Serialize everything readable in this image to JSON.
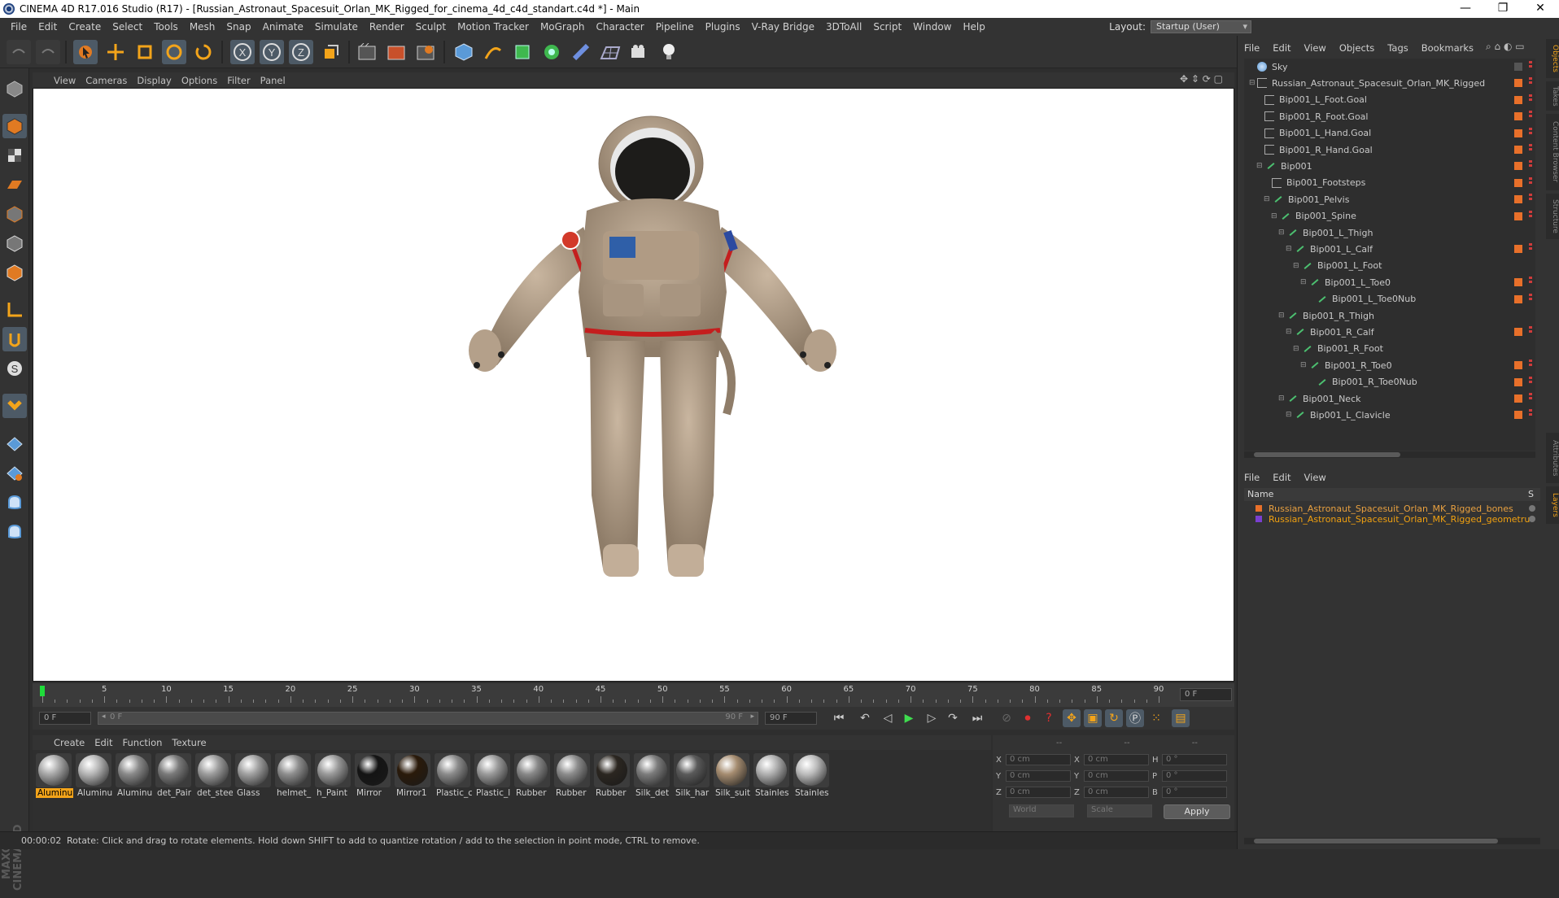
{
  "window": {
    "title": "CINEMA 4D R17.016 Studio (R17) - [Russian_Astronaut_Spacesuit_Orlan_MK_Rigged_for_cinema_4d_c4d_standart.c4d *] - Main",
    "minimize": "—",
    "restore": "❐",
    "close": "✕"
  },
  "menu": [
    "File",
    "Edit",
    "Create",
    "Select",
    "Tools",
    "Mesh",
    "Snap",
    "Animate",
    "Simulate",
    "Render",
    "Sculpt",
    "Motion Tracker",
    "MoGraph",
    "Character",
    "Pipeline",
    "Plugins",
    "V-Ray Bridge",
    "3DToAll",
    "Script",
    "Window",
    "Help"
  ],
  "layout": {
    "label": "Layout:",
    "value": "Startup (User)"
  },
  "toolbar": {
    "undo": "undo-icon",
    "redo": "redo-icon",
    "select": "select-icon",
    "move": "move-icon",
    "scale": "scale-icon",
    "rotate": "rotate-icon",
    "x_axis": "X",
    "y_axis": "Y",
    "z_axis": "Z"
  },
  "viewport_menu": [
    "View",
    "Cameras",
    "Display",
    "Options",
    "Filter",
    "Panel"
  ],
  "timeline": {
    "ticks": [
      "0",
      "5",
      "10",
      "15",
      "20",
      "25",
      "30",
      "35",
      "40",
      "45",
      "50",
      "55",
      "60",
      "65",
      "70",
      "75",
      "80",
      "85",
      "90"
    ],
    "current_frame": "0 F",
    "start_frame": "0 F",
    "range_start": "0 F",
    "range_end": "90 F",
    "end_frame": "90 F"
  },
  "material_menu": [
    "Create",
    "Edit",
    "Function",
    "Texture"
  ],
  "materials": [
    {
      "label": "Aluminu",
      "color": "#a8a8a8",
      "active": true
    },
    {
      "label": "Aluminu",
      "color": "#b5b5b5"
    },
    {
      "label": "Aluminu",
      "color": "#8a8a8a"
    },
    {
      "label": "det_Pair",
      "color": "#7a7a7a"
    },
    {
      "label": "det_stee",
      "color": "#9c9c9c"
    },
    {
      "label": "Glass",
      "color": "#a0a0a0"
    },
    {
      "label": "helmet_",
      "color": "#8e8e8e"
    },
    {
      "label": "h_Paint",
      "color": "#999999"
    },
    {
      "label": "Mirror",
      "color": "#141414"
    },
    {
      "label": "Mirror1",
      "color": "#2a1a0a"
    },
    {
      "label": "Plastic_c",
      "color": "#8b8b8b"
    },
    {
      "label": "Plastic_l",
      "color": "#9a9a9a"
    },
    {
      "label": "Rubber",
      "color": "#888888"
    },
    {
      "label": "Rubber",
      "color": "#8c8c8c"
    },
    {
      "label": "Rubber",
      "color": "#2b2620"
    },
    {
      "label": "Silk_det",
      "color": "#7c7c7c"
    },
    {
      "label": "Silk_har",
      "color": "#5a5a5a"
    },
    {
      "label": "Silk_suit",
      "color": "#a58c70"
    },
    {
      "label": "Stainles",
      "color": "#b0b0b0"
    },
    {
      "label": "Stainles",
      "color": "#bcbcbc"
    }
  ],
  "coords": {
    "header": [
      "--",
      "--",
      "--"
    ],
    "rows": [
      {
        "a": "X",
        "av": "0 cm",
        "b": "X",
        "bv": "0 cm",
        "c": "H",
        "cv": "0 °"
      },
      {
        "a": "Y",
        "av": "0 cm",
        "b": "Y",
        "bv": "0 cm",
        "c": "P",
        "cv": "0 °"
      },
      {
        "a": "Z",
        "av": "0 cm",
        "b": "Z",
        "bv": "0 cm",
        "c": "B",
        "cv": "0 °"
      }
    ],
    "world": "World",
    "scale": "Scale",
    "apply": "Apply"
  },
  "status": {
    "time": "00:00:02",
    "message": "Rotate: Click and drag to rotate elements. Hold down SHIFT to add to quantize rotation / add to the selection in point mode, CTRL to remove."
  },
  "object_menu": [
    "File",
    "Edit",
    "View",
    "Objects",
    "Tags",
    "Bookmarks"
  ],
  "objects": [
    {
      "name": "Sky",
      "indent": 0,
      "kind": "sky"
    },
    {
      "name": "Russian_Astronaut_Spacesuit_Orlan_MK_Rigged",
      "indent": 0,
      "kind": "null",
      "exp": "⊟"
    },
    {
      "name": "Bip001_L_Foot.Goal",
      "indent": 1,
      "kind": "null"
    },
    {
      "name": "Bip001_R_Foot.Goal",
      "indent": 1,
      "kind": "null"
    },
    {
      "name": "Bip001_L_Hand.Goal",
      "indent": 1,
      "kind": "null"
    },
    {
      "name": "Bip001_R_Hand.Goal",
      "indent": 1,
      "kind": "null"
    },
    {
      "name": "Bip001",
      "indent": 1,
      "kind": "bone",
      "exp": "⊟"
    },
    {
      "name": "Bip001_Footsteps",
      "indent": 2,
      "kind": "null"
    },
    {
      "name": "Bip001_Pelvis",
      "indent": 2,
      "kind": "bone",
      "exp": "⊟"
    },
    {
      "name": "Bip001_Spine",
      "indent": 3,
      "kind": "bone",
      "exp": "⊟"
    },
    {
      "name": "Bip001_L_Thigh",
      "indent": 4,
      "kind": "bone",
      "exp": "⊟",
      "extra": "ik"
    },
    {
      "name": "Bip001_L_Calf",
      "indent": 5,
      "kind": "bone",
      "exp": "⊟"
    },
    {
      "name": "Bip001_L_Foot",
      "indent": 6,
      "kind": "bone",
      "exp": "⊟",
      "extra": "ik"
    },
    {
      "name": "Bip001_L_Toe0",
      "indent": 7,
      "kind": "bone",
      "exp": "⊟"
    },
    {
      "name": "Bip001_L_Toe0Nub",
      "indent": 8,
      "kind": "bone"
    },
    {
      "name": "Bip001_R_Thigh",
      "indent": 4,
      "kind": "bone",
      "exp": "⊟",
      "extra": "ik"
    },
    {
      "name": "Bip001_R_Calf",
      "indent": 5,
      "kind": "bone",
      "exp": "⊟"
    },
    {
      "name": "Bip001_R_Foot",
      "indent": 6,
      "kind": "bone",
      "exp": "⊟",
      "extra": "ik"
    },
    {
      "name": "Bip001_R_Toe0",
      "indent": 7,
      "kind": "bone",
      "exp": "⊟"
    },
    {
      "name": "Bip001_R_Toe0Nub",
      "indent": 8,
      "kind": "bone"
    },
    {
      "name": "Bip001_Neck",
      "indent": 4,
      "kind": "bone",
      "exp": "⊟"
    },
    {
      "name": "Bip001_L_Clavicle",
      "indent": 5,
      "kind": "bone",
      "exp": "⊟"
    }
  ],
  "layer_menu": [
    "File",
    "Edit",
    "View"
  ],
  "layer_header": "Name",
  "layer_header_s": "S",
  "layers": [
    {
      "name": "Russian_Astronaut_Spacesuit_Orlan_MK_Rigged_bones",
      "color": "#e8702a",
      "text": "#e8a040"
    },
    {
      "name": "Russian_Astronaut_Spacesuit_Orlan_MK_Rigged_geometru",
      "color": "#7a3fd0",
      "text": "#f0a010"
    }
  ],
  "side_tabs": [
    "Objects",
    "Takes",
    "Content Browser",
    "Structure",
    "Attributes",
    "Layers"
  ],
  "maxon": "MAXON CINEMA 4D"
}
